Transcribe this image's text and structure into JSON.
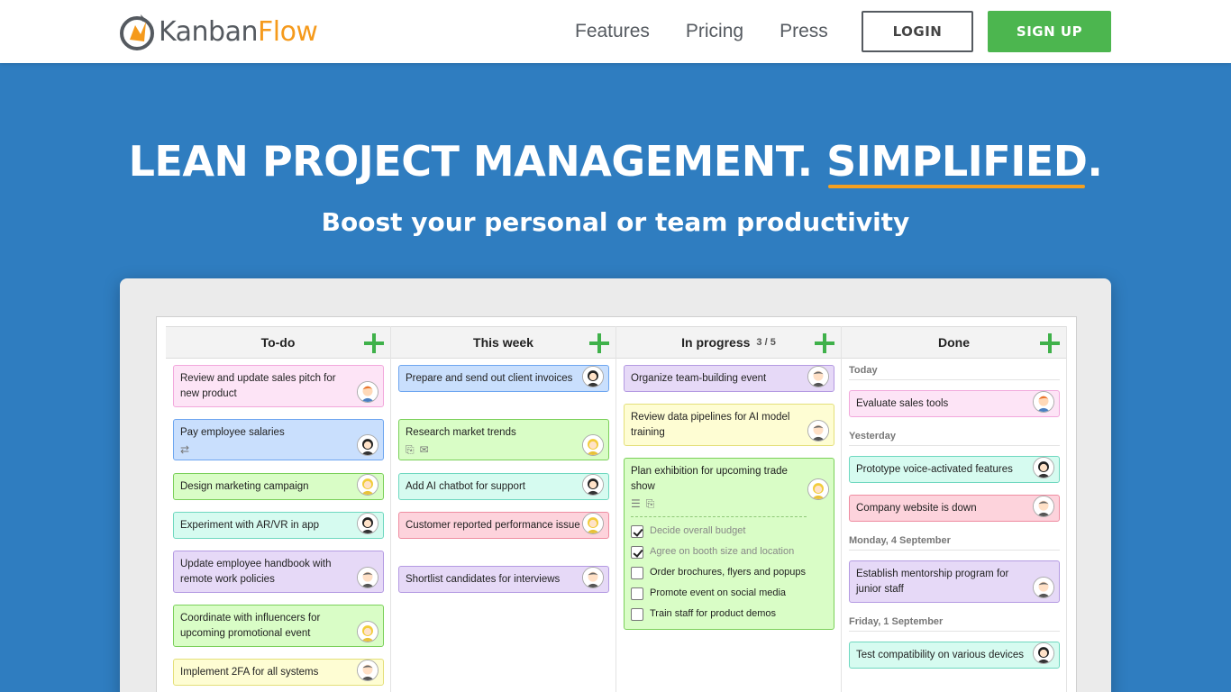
{
  "nav": {
    "logo_part1": "Kanban",
    "logo_part2": "Flow",
    "links": [
      "Features",
      "Pricing",
      "Press"
    ],
    "login": "LOGIN",
    "signup": "SIGN UP"
  },
  "hero": {
    "title_main": "LEAN PROJECT MANAGEMENT. ",
    "title_highlight": "SIMPLIFIED",
    "title_end": ".",
    "subtitle": "Boost your personal or team productivity"
  },
  "colors": {
    "hero_bg": "#2f7dc0",
    "accent": "#f5a020",
    "signup_green": "#4cb64f"
  },
  "board": {
    "columns": [
      {
        "title": "To-do",
        "cards": [
          {
            "text": "Review and update sales pitch for new product",
            "color": "pink",
            "avatar": "man-orange"
          },
          {
            "text": "Pay employee salaries",
            "color": "blue",
            "avatar": "woman-dark",
            "icons": [
              "repeat-icon"
            ]
          },
          {
            "text": "Design marketing campaign",
            "color": "green",
            "avatar": "woman-blonde"
          },
          {
            "text": "Experiment with AR/VR in app",
            "color": "teal",
            "avatar": "woman-dark"
          },
          {
            "text": "Update employee handbook with remote work policies",
            "color": "purple",
            "avatar": "man-grey"
          },
          {
            "text": "Coordinate with influencers for upcoming promotional event",
            "color": "green",
            "avatar": "woman-blonde"
          },
          {
            "text": "Implement 2FA for all systems",
            "color": "yellow",
            "avatar": "man-grey"
          }
        ]
      },
      {
        "title": "This week",
        "cards": [
          {
            "text": "Prepare and send out client invoices",
            "color": "blue",
            "avatar": "woman-dark"
          },
          {
            "text": "Research market trends",
            "color": "green",
            "avatar": "woman-blonde",
            "icons": [
              "attachment-icon",
              "comment-icon"
            ]
          },
          {
            "text": "Add AI chatbot for support",
            "color": "teal",
            "avatar": "woman-dark"
          },
          {
            "text": "Customer reported performance issue",
            "color": "red",
            "avatar": "woman-blonde"
          },
          {
            "text": "Shortlist candidates for interviews",
            "color": "purple",
            "avatar": "man-grey"
          }
        ]
      },
      {
        "title": "In progress",
        "wip": "3 / 5",
        "cards": [
          {
            "text": "Organize team-building event",
            "color": "purple",
            "avatar": "man-grey"
          },
          {
            "text": "Review data pipelines for AI model training",
            "color": "yellow",
            "avatar": "man-grey"
          },
          {
            "text": "Plan exhibition for upcoming trade show",
            "color": "green",
            "avatar": "woman-blonde",
            "icons": [
              "checklist-icon",
              "attachment-icon"
            ],
            "subtasks": [
              {
                "label": "Decide overall budget",
                "done": true
              },
              {
                "label": "Agree on booth size and location",
                "done": true
              },
              {
                "label": "Order brochures, flyers and popups",
                "done": false
              },
              {
                "label": "Promote event on social media",
                "done": false
              },
              {
                "label": "Train staff for product demos",
                "done": false
              }
            ]
          }
        ]
      },
      {
        "title": "Done",
        "groups": [
          {
            "label": "Today",
            "cards": [
              {
                "text": "Evaluate sales tools",
                "color": "pink",
                "avatar": "man-orange"
              }
            ]
          },
          {
            "label": "Yesterday",
            "cards": [
              {
                "text": "Prototype voice-activated features",
                "color": "teal",
                "avatar": "woman-dark"
              },
              {
                "text": "Company website is down",
                "color": "red",
                "avatar": "man-grey"
              }
            ]
          },
          {
            "label": "Monday, 4 September",
            "cards": [
              {
                "text": "Establish mentorship program for junior staff",
                "color": "purple",
                "avatar": "man-grey"
              }
            ]
          },
          {
            "label": "Friday, 1 September",
            "cards": [
              {
                "text": "Test compatibility on various devices",
                "color": "teal",
                "avatar": "woman-dark"
              }
            ]
          }
        ]
      }
    ]
  }
}
